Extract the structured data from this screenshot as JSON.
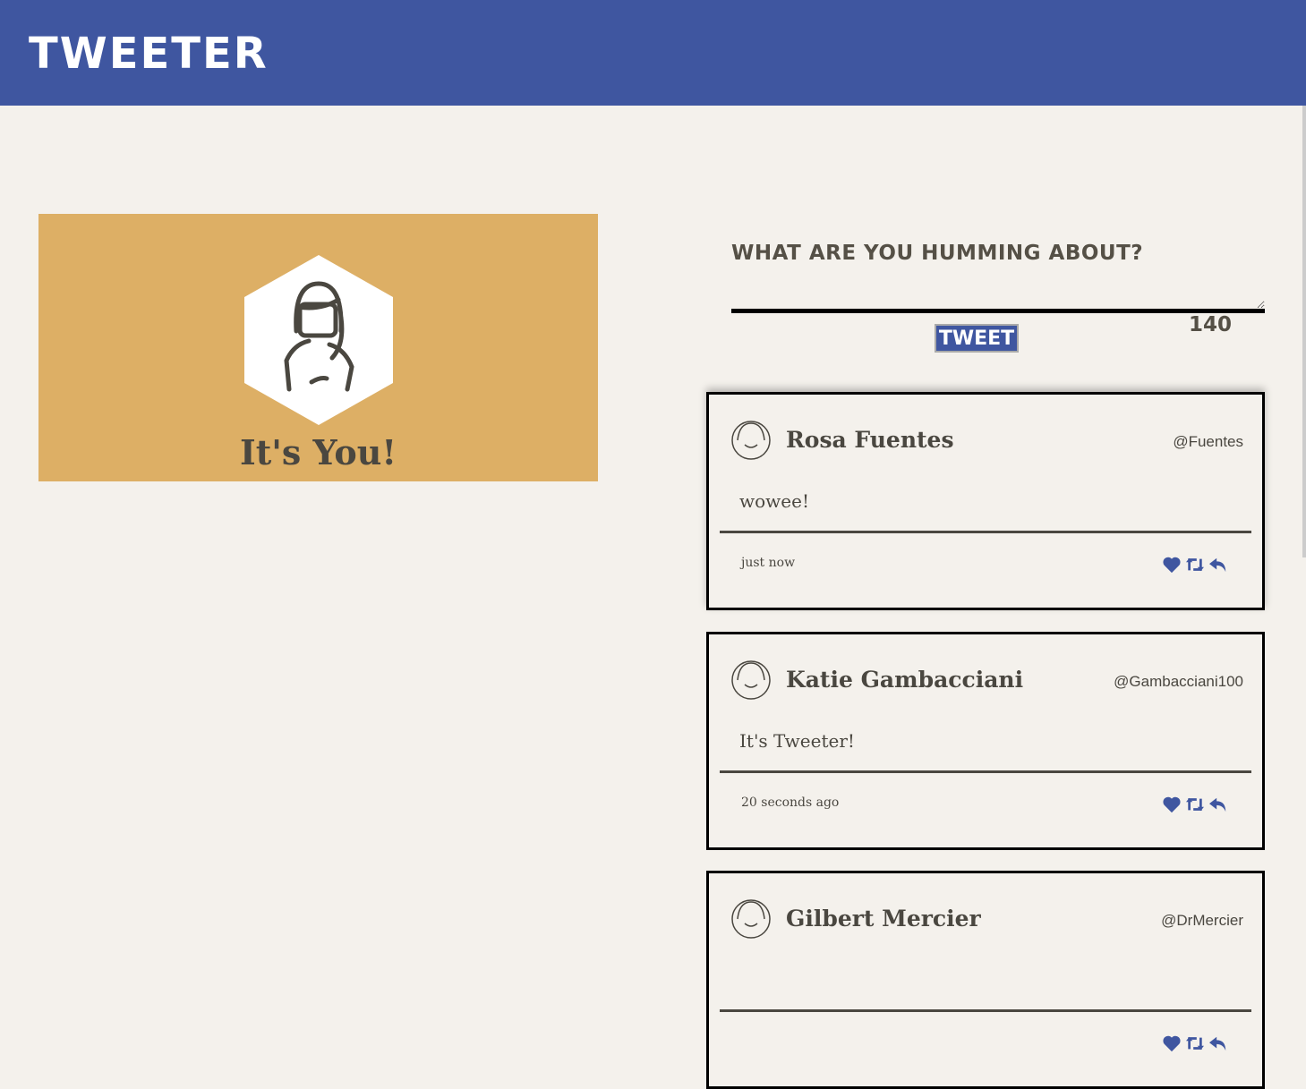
{
  "header": {
    "title": "TWEETER"
  },
  "profile": {
    "caption": "It's You!",
    "avatar_icon": "woman-avatar-icon"
  },
  "compose": {
    "prompt": "WHAT ARE YOU HUMMING ABOUT?",
    "value": "",
    "button_label": "TWEET",
    "counter": "140"
  },
  "colors": {
    "brand": "#3f56a0",
    "profile_bg": "#ddaf65",
    "background": "#f4f1ec"
  },
  "tweets": [
    {
      "name": "Rosa Fuentes",
      "handle": "@Fuentes",
      "text": "wowee!",
      "time": "just now"
    },
    {
      "name": "Katie Gambacciani",
      "handle": "@Gambacciani100",
      "text": "It's Tweeter!",
      "time": "20 seconds ago"
    },
    {
      "name": "Gilbert Mercier",
      "handle": "@DrMercier",
      "text": "",
      "time": ""
    }
  ]
}
